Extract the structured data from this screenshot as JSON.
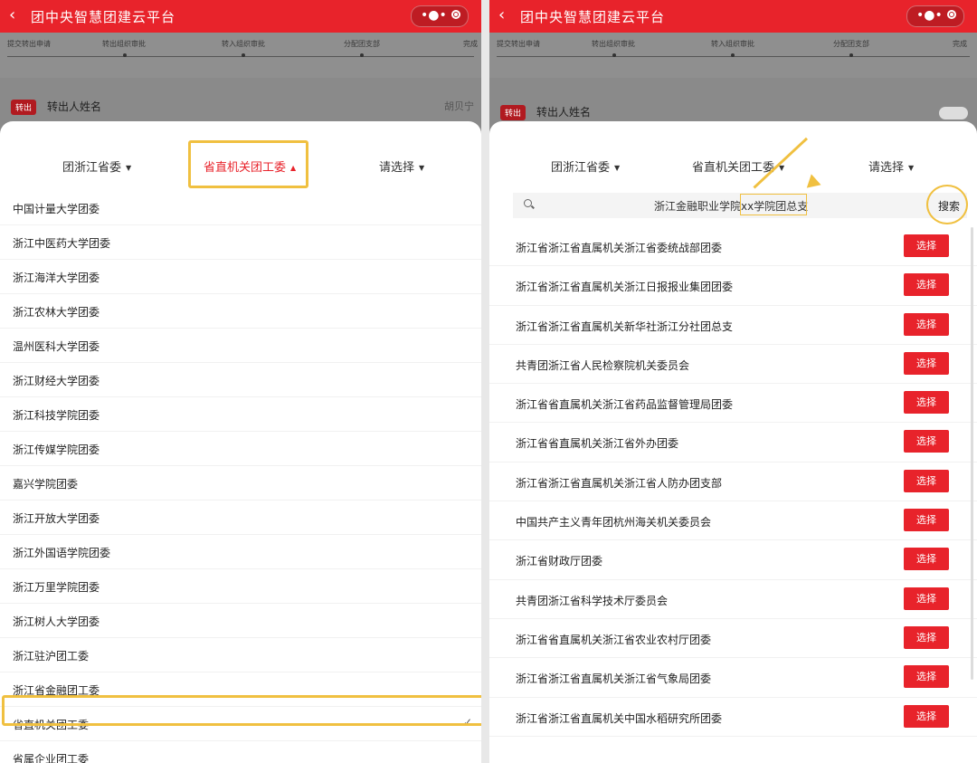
{
  "left": {
    "app_title": "团中央智慧团建云平台",
    "steps": [
      "提交转出申请",
      "转出组织审批",
      "转入组织审批",
      "分配团支部",
      "完成"
    ],
    "bg_tag": "转出",
    "bg_label": "转出人姓名",
    "bg_value": "胡贝宁",
    "filters": [
      {
        "label": "团浙江省委",
        "caret": "▼"
      },
      {
        "label": "省直机关团工委",
        "caret": "▲"
      },
      {
        "label": "请选择",
        "caret": "▼"
      }
    ],
    "items": [
      "中国计量大学团委",
      "浙江中医药大学团委",
      "浙江海洋大学团委",
      "浙江农林大学团委",
      "温州医科大学团委",
      "浙江财经大学团委",
      "浙江科技学院团委",
      "浙江传媒学院团委",
      "嘉兴学院团委",
      "浙江开放大学团委",
      "浙江外国语学院团委",
      "浙江万里学院团委",
      "浙江树人大学团委",
      "浙江驻沪团工委",
      "浙江省金融团工委",
      "省直机关团工委",
      "省属企业团工委"
    ],
    "selected_check": "✓"
  },
  "right": {
    "app_title": "团中央智慧团建云平台",
    "steps": [
      "提交转出申请",
      "转出组织审批",
      "转入组织审批",
      "分配团支部",
      "完成"
    ],
    "bg_tag": "转出",
    "bg_label": "转出人姓名",
    "filters": [
      {
        "label": "团浙江省委",
        "caret": "▼"
      },
      {
        "label": "省直机关团工委",
        "caret": "▼"
      },
      {
        "label": "请选择",
        "caret": "▼"
      }
    ],
    "search_value": "浙江金融职业学院xx学院团总支",
    "search_button": "搜索",
    "select_label": "选择",
    "items": [
      "浙江省浙江省直属机关浙江省委统战部团委",
      "浙江省浙江省直属机关浙江日报报业集团团委",
      "浙江省浙江省直属机关新华社浙江分社团总支",
      "共青团浙江省人民检察院机关委员会",
      "浙江省省直属机关浙江省药品监督管理局团委",
      "浙江省省直属机关浙江省外办团委",
      "浙江省浙江省直属机关浙江省人防办团支部",
      "中国共产主义青年团杭州海关机关委员会",
      "浙江省财政厅团委",
      "共青团浙江省科学技术厅委员会",
      "浙江省省直属机关浙江省农业农村厅团委",
      "浙江省浙江省直属机关浙江省气象局团委",
      "浙江省浙江省直属机关中国水稻研究所团委"
    ]
  }
}
